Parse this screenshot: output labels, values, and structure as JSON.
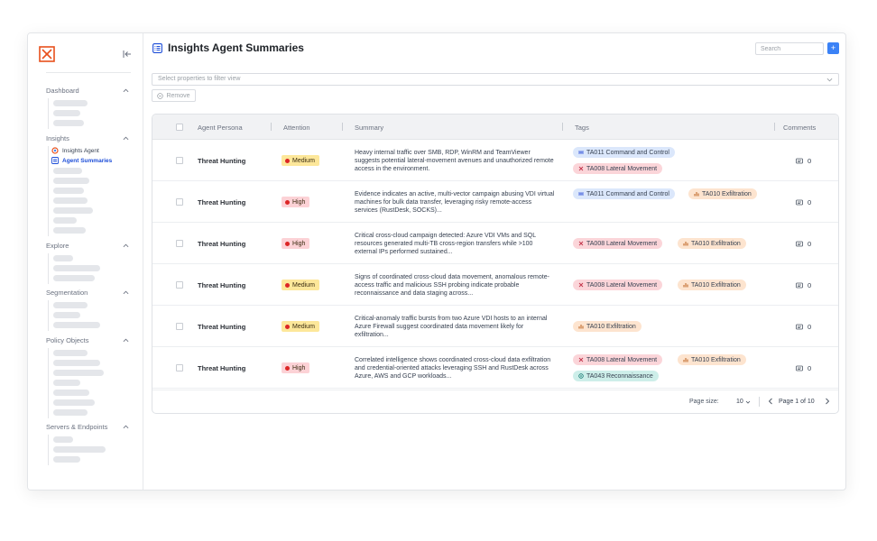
{
  "sidebar": {
    "sections": [
      {
        "label": "Dashboard"
      },
      {
        "label": "Insights",
        "items": [
          {
            "label": "Insights Agent"
          },
          {
            "label": "Agent Summaries"
          }
        ]
      },
      {
        "label": "Explore"
      },
      {
        "label": "Segmentation"
      },
      {
        "label": "Policy Objects"
      },
      {
        "label": "Servers & Endpoints"
      }
    ]
  },
  "header": {
    "title": "Insights Agent Summaries",
    "search_placeholder": "Search",
    "add_label": "+"
  },
  "filter": {
    "placeholder": "Select properties to filter view",
    "remove_label": "Remove"
  },
  "table": {
    "columns": [
      "Agent Persona",
      "Attention",
      "Summary",
      "Tags",
      "Comments"
    ],
    "rows": [
      {
        "persona": "Threat Hunting",
        "attention": "Medium",
        "summary": "Heavy internal traffic over SMB, RDP, WinRM and TeamViewer suggests potential lateral-movement avenues and unauthorized remote access in the environment.",
        "tags": [
          {
            "label": "TA011 Command and Control",
            "color": "blue"
          },
          {
            "label": "TA008 Lateral Movement",
            "color": "red"
          }
        ],
        "comments": "0"
      },
      {
        "persona": "Threat Hunting",
        "attention": "High",
        "summary": "Evidence indicates an active, multi-vector campaign abusing VDI virtual machines for bulk data transfer, leveraging risky remote-access services (RustDesk, SOCKS)...",
        "tags": [
          {
            "label": "TA011 Command and Control",
            "color": "blue"
          },
          {
            "label": "TA010 Exfiltration",
            "color": "orange"
          }
        ],
        "comments": "0"
      },
      {
        "persona": "Threat Hunting",
        "attention": "High",
        "summary": "Critical cross-cloud campaign detected: Azure VDI VMs and SQL resources generated multi-TB cross-region transfers while >100 external IPs performed sustained...",
        "tags": [
          {
            "label": "TA008 Lateral Movement",
            "color": "red"
          },
          {
            "label": "TA010 Exfiltration",
            "color": "orange"
          }
        ],
        "comments": "0"
      },
      {
        "persona": "Threat Hunting",
        "attention": "Medium",
        "summary": "Signs of coordinated cross-cloud data movement, anomalous remote-access traffic and malicious SSH probing indicate probable reconnaissance and data staging across...",
        "tags": [
          {
            "label": "TA008 Lateral Movement",
            "color": "red"
          },
          {
            "label": "TA010 Exfiltration",
            "color": "orange"
          }
        ],
        "comments": "0"
      },
      {
        "persona": "Threat Hunting",
        "attention": "Medium",
        "summary": "Critical-anomaly traffic bursts from two Azure VDI hosts to an internal Azure Firewall suggest coordinated data movement likely for exfiltration...",
        "tags": [
          {
            "label": "TA010 Exfiltration",
            "color": "orange"
          }
        ],
        "comments": "0"
      },
      {
        "persona": "Threat Hunting",
        "attention": "High",
        "summary": "Correlated intelligence shows coordinated cross-cloud data exfiltration and credential-oriented attacks leveraging SSH and RustDesk across Azure, AWS and GCP workloads...",
        "tags": [
          {
            "label": "TA008 Lateral Movement",
            "color": "red"
          },
          {
            "label": "TA010 Exfiltration",
            "color": "orange"
          },
          {
            "label": "TA043 Reconnaissance",
            "color": "teal"
          }
        ],
        "comments": "0"
      }
    ]
  },
  "pager": {
    "size_label": "Page size:",
    "size_value": "10",
    "page_text": "Page 1 of 10"
  },
  "colors": {
    "accent": "#3b82f6",
    "logo": "#e8501c",
    "medium_badge": "#fde79a",
    "high_badge": "#fcd2d6",
    "alert_dot": "#dc2626"
  }
}
